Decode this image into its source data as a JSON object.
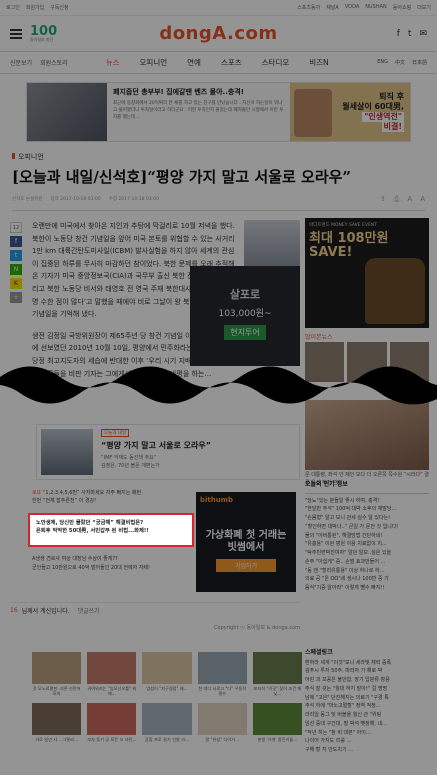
{
  "topbar": {
    "left": [
      "로그인",
      "회원가입",
      "구독신청"
    ],
    "right": [
      "스포츠동아",
      "채널A",
      "VODA",
      "NUSHAN",
      "동아쇼핑",
      "더보기"
    ]
  },
  "header": {
    "anniv_mark": "100",
    "anniv_sub": "동아일보 창간",
    "brand": "dongA.com",
    "social": [
      "f",
      "t",
      "✉"
    ]
  },
  "nav": {
    "left": [
      "신문보기",
      "회원스토리"
    ],
    "mid": [
      "뉴스",
      "오피니언",
      "연예",
      "스포츠",
      "스타디오",
      "비즈N"
    ],
    "right": [
      "ENG",
      "中文",
      "日本語"
    ]
  },
  "ad_banner": {
    "headline": "폐지줍던 총부부! 집에갈땐 벤츠 몰아..충격!",
    "body": "최근에 동창회에서 20억짜리 한 채를 하고 있는 친구를 만났습니다 . 자신이 하는일이 뭐냐고 물어봤더니 투자일이라고 하더군요 . 어떤 투자인지 물었는데 폐지줍던 시절에서 이런 투자를 했는데…",
    "promo_line1": "퇴직 후",
    "promo_line2": "월세살이 60대男,",
    "promo_line3": "\"인생역전\"",
    "promo_line4": "비결!"
  },
  "article": {
    "section": "오피니언",
    "title": "[오늘과 내일/신석호]“평양 가지 말고 서울로 오라우”",
    "byline": "신석호 논설위원",
    "date1": "입력 2017-10-18 03:00",
    "date2": "수정 2017-10-18 03:00",
    "share_count": "12",
    "paragraphs": [
      "오랜만에 미국에서 찾아온 지인과 추탕에 막걸리로 10월 저녁을 했다. 북한이 노동당 창건 기념일을 앞어 미국 본토를 위협할 수 있는 사거리 1만 km 대륙간탄도미사일(ICBM) 발사실험을 하지 않아 세계의 관심이 집중된 하루를 무사히 마감하던 참이었다. 북한 문제를 오래 추적해 온 기자가 미국 중앙정보국(CIA)과 국무부 출신 북한 전문가들 부인 그리고 북한 노동당 비서와 태영호 전 영국 주재 북한대사관 공사 등이 망명 수한 점이 많다’고 말했을 때에야 비로 그날이 왕 북한 노동당 창건 기념일을 기억해 냈다.",
      "생전 김정일 국방위원장이 제65주년 당 창건 기념일 야간 행사에 대리고 나와 처음 국제사회에 선보였던 2010년 10월 10일, 평양에서 민주화라는 일념이 갖추 온다 준 재 간격의 욕차 당정 최고지도자의 세습에 반대한 이후 ‘우리 시기 지배 시공에 흐르는 해 갈비탕을 한 지는 이 남문들을 비판 기자는 그에게서 참대 무언의 비평을 하는…"
    ],
    "movie_ad": {
      "t1": "살포로",
      "t2": "103,000원~",
      "t3": "현지투어"
    }
  },
  "related": {
    "tag": "오늘과 내일",
    "headline": "“평양 가지 말고 서울로 오라우”",
    "bullets": [
      "“IMF 악재도 동선책 주요”",
      "김정은, 70년 볼문 개편는가"
    ]
  },
  "promos": {
    "label": "로또",
    "items": [
      "“1,2,3,4,5,6번” 사지마세요 자주 빠지는 패턴",
      "한번 “전체 잡추른천” 이 경강!"
    ],
    "highlight_line1": "노안생체, 당신만 몰랐던 “궁금해” 해결비법은?",
    "highlight_line2": "은퇴후 막막한 50대男, 서민갑부 된 비법...화제!!",
    "more": [
      "A생생 견로사 여상 대장님 수상이 좋게??",
      "군인들고 10만원으로 40억 벌어들인 20대 전에자 자제!"
    ]
  },
  "bithumb": {
    "logo": "bithumb",
    "hero_l1": "가상화폐 첫 거래는",
    "hero_l2": "빗썸에서",
    "cta": "가입하기"
  },
  "comment_row": {
    "count": "16",
    "text": "님께서 계신입니다.",
    "link": "댓글쓰기"
  },
  "copyright": "Copyright ⓒ 동아일보 & donga.com",
  "sidebar": {
    "ad_top": "바디프랜드 MONEY SAVE EVENT",
    "ad_big_l1": "최대 108만원",
    "ad_big_l2": "SAVE!",
    "section_title": "많이본뉴스",
    "lady_caption": "문 대통령, 좌석 안 제안 보다 더 오른쪽 쪽수원 “시라다” 결론 우선 작가 관련",
    "list_header": "오늘의 인기 정보",
    "list": [
      "\"당뇨\"있는 분들일 좋시 하여, 충격!",
      "\"한달만 추석\" 100억 대박 소후의 재발당...",
      "\"손몸형\" 알고 보니 관세 실수 알 있다는!",
      "“할인하면 대박나..” 큰일 가 문전 것 입니다!",
      "물의 \"아버통된\", 해결방법 간단하네!",
      "\"유흥용\" 이된 병원 이용 치료없이 치...",
      "\"탁주빈련박진여자\" 알던 알보..실은 있을",
      "손주 \"아쉽게\" 중.. 손벌 효과만들어 ...",
      "\"동 앤 \"할리유통용\" 이상 하나로 하...",
      "의료 공 \"온 OO\"세 생시나 100만 중 기",
      "음식\"기증 알아라\" 이렇게 뺄수 빠지!!"
    ],
    "list2_header": "스페셜링크",
    "list2": [
      "환하라 세계 \"이것\"보니 세라빛 체력 증폭",
      "광주시 투자 50주, 마라자 가 해로 박",
      "어린 과 꼬꽁은 불안합, 장기 압분류 창용",
      "주식 잘 갖는 \"월대 하지 말아!\" 걸 명명",
      "남에 \"고은\" 단진해지는 의료기 \"구경 특",
      "추석 하에 \"마노고멀할\" 정역 적정...",
      "라리일 동그 및 버블을 월신 관 \"위팅",
      "임선 증대 구건대, 벌 박석 뺏정해, 내...",
      "\"작년 하는 \"참 비 대본\" 아이...",
      "나이어 가지도 리를 ...",
      "구해 할 지 안도치기 ..."
    ]
  },
  "thumbs": [
    {
      "cap": "갓 모노료평판..지른 선먼저모아",
      "color": "#b9a07e"
    },
    {
      "cap": "귀여워지는 \"입모선오를\" 위해...",
      "color": "#c47a6a"
    },
    {
      "cap": "엄청이 \"지구경점\" 제...",
      "color": "#d9c7a3"
    },
    {
      "cap": "찬 마디 사로고 \"다\" 꾸동작 필수",
      "color": "#9aa8b6"
    },
    {
      "cap": "포지석 \"이곳\" 찾이 조건 해낮...",
      "color": "#6c7d4d"
    },
    {
      "cap": "가로 일년 사... 그렇라...",
      "color": "#806a5a"
    },
    {
      "cap": "부자 동기 공 모든 오 사진...",
      "color": "#c86a5c"
    },
    {
      "cap": "혼합 프로 걸치 선발 가...",
      "color": "#a7b4c1"
    },
    {
      "cap": "알 \"완성\" 다이거...",
      "color": "#e0d2c0"
    },
    {
      "cap": "분영 '가개' 종진이들...",
      "color": "#5d8a3b"
    }
  ]
}
